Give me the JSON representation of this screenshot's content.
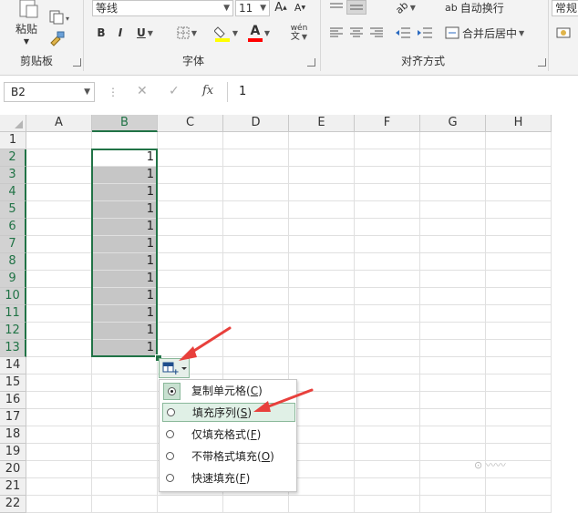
{
  "ribbon": {
    "clipboard": {
      "paste_label": "粘贴",
      "group_label": "剪贴板"
    },
    "font": {
      "font_name": "等线",
      "font_size": "11",
      "bold": "B",
      "italic": "I",
      "underline": "U",
      "font_color_letter": "A",
      "grow_font": "A",
      "shrink_font": "A",
      "phonetic": "wén",
      "group_label": "字体",
      "font_color": "#ff0000",
      "highlight_color": "#ffff00"
    },
    "alignment": {
      "wrap_text": "自动换行",
      "merge_center": "合并后居中",
      "group_label": "对齐方式"
    },
    "number": {
      "format": "常规"
    }
  },
  "formula_bar": {
    "name_box": "B2",
    "fx_label": "fx",
    "cancel": "✕",
    "enter": "✓",
    "value": "1"
  },
  "sheet": {
    "columns": [
      "A",
      "B",
      "C",
      "D",
      "E",
      "F",
      "G",
      "H"
    ],
    "rows": [
      "1",
      "2",
      "3",
      "4",
      "5",
      "6",
      "7",
      "8",
      "9",
      "10",
      "11",
      "12",
      "13",
      "14",
      "15",
      "16",
      "17",
      "18",
      "19",
      "20",
      "21",
      "22"
    ],
    "column_b_values": [
      "",
      "1",
      "1",
      "1",
      "1",
      "1",
      "1",
      "1",
      "1",
      "1",
      "1",
      "1",
      "1"
    ],
    "selected_column": "B",
    "accent_color": "#217346"
  },
  "autofill_menu": {
    "items": [
      {
        "label": "复制单元格",
        "key": "C"
      },
      {
        "label": "填充序列",
        "key": "S"
      },
      {
        "label": "仅填充格式",
        "key": "F"
      },
      {
        "label": "不带格式填充",
        "key": "O"
      },
      {
        "label": "快速填充",
        "key": "F"
      }
    ],
    "checked_index": 0,
    "hover_index": 1
  },
  "annotation_color": "#e8403c"
}
